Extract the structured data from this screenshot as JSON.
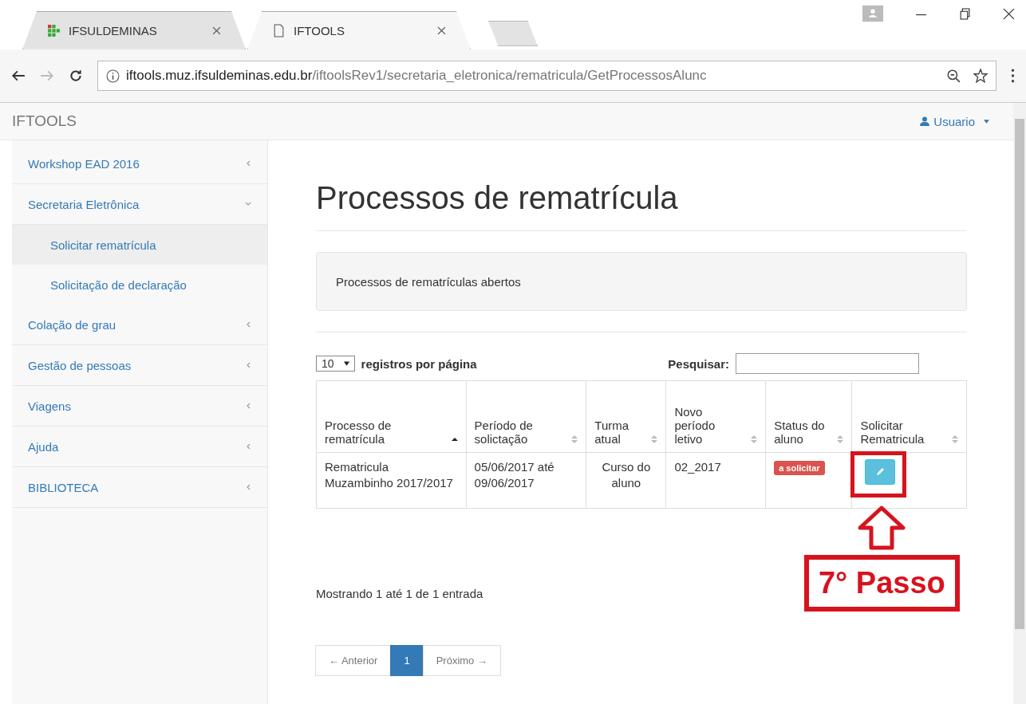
{
  "browser": {
    "tabs": [
      {
        "title": "IFSULDEMINAS",
        "selected": false,
        "kind": "site"
      },
      {
        "title": "IFTOOLS",
        "selected": true,
        "kind": "page"
      }
    ],
    "address": {
      "domain": "iftools.muz.ifsuldeminas.edu.br",
      "path": "/iftoolsRev1/secretaria_eletronica/rematricula/GetProcessosAlunc"
    }
  },
  "navbar": {
    "brand": "IFTOOLS",
    "user": "Usuario"
  },
  "sidebar": {
    "items": [
      {
        "label": "Workshop EAD 2016",
        "expanded": false
      },
      {
        "label": "Secretaria Eletrônica",
        "expanded": true,
        "children": [
          {
            "label": "Solicitar rematrícula",
            "selected": true
          },
          {
            "label": "Solicitação de declaração",
            "selected": false
          }
        ]
      },
      {
        "label": "Colação de grau",
        "expanded": false
      },
      {
        "label": "Gestão de pessoas",
        "expanded": false
      },
      {
        "label": "Viagens",
        "expanded": false
      },
      {
        "label": "Ajuda",
        "expanded": false
      },
      {
        "label": "BIBLIOTECA",
        "expanded": false
      }
    ]
  },
  "page": {
    "title": "Processos de rematrícula",
    "panel": "Processos de rematrículas abertos",
    "length": {
      "value": "10",
      "label": "registros por página"
    },
    "search": {
      "label": "Pesquisar:"
    },
    "table": {
      "columns": [
        {
          "label": "Processo de rematrícula",
          "sorted": true
        },
        {
          "label": "Período de solictação",
          "sorted": false
        },
        {
          "label": "Turma atual",
          "sorted": false
        },
        {
          "label": "Novo período letivo",
          "sorted": false
        },
        {
          "label": "Status do aluno",
          "sorted": false
        },
        {
          "label": "Solicitar Rematricula",
          "sorted": false
        }
      ],
      "rows": [
        {
          "process": "Rematricula Muzambinho 2017/2017",
          "period": "05/06/2017 até 09/06/2017",
          "class": "Curso do aluno",
          "new_period": "02_2017",
          "status": "a solicitar"
        }
      ]
    },
    "info": "Mostrando 1 até 1 de 1 entrada",
    "pagination": [
      {
        "label": "← Anterior",
        "selected": false
      },
      {
        "label": "1",
        "selected": true
      },
      {
        "label": "Próximo →",
        "selected": false
      }
    ]
  },
  "annotation": {
    "label": "7° Passo"
  }
}
